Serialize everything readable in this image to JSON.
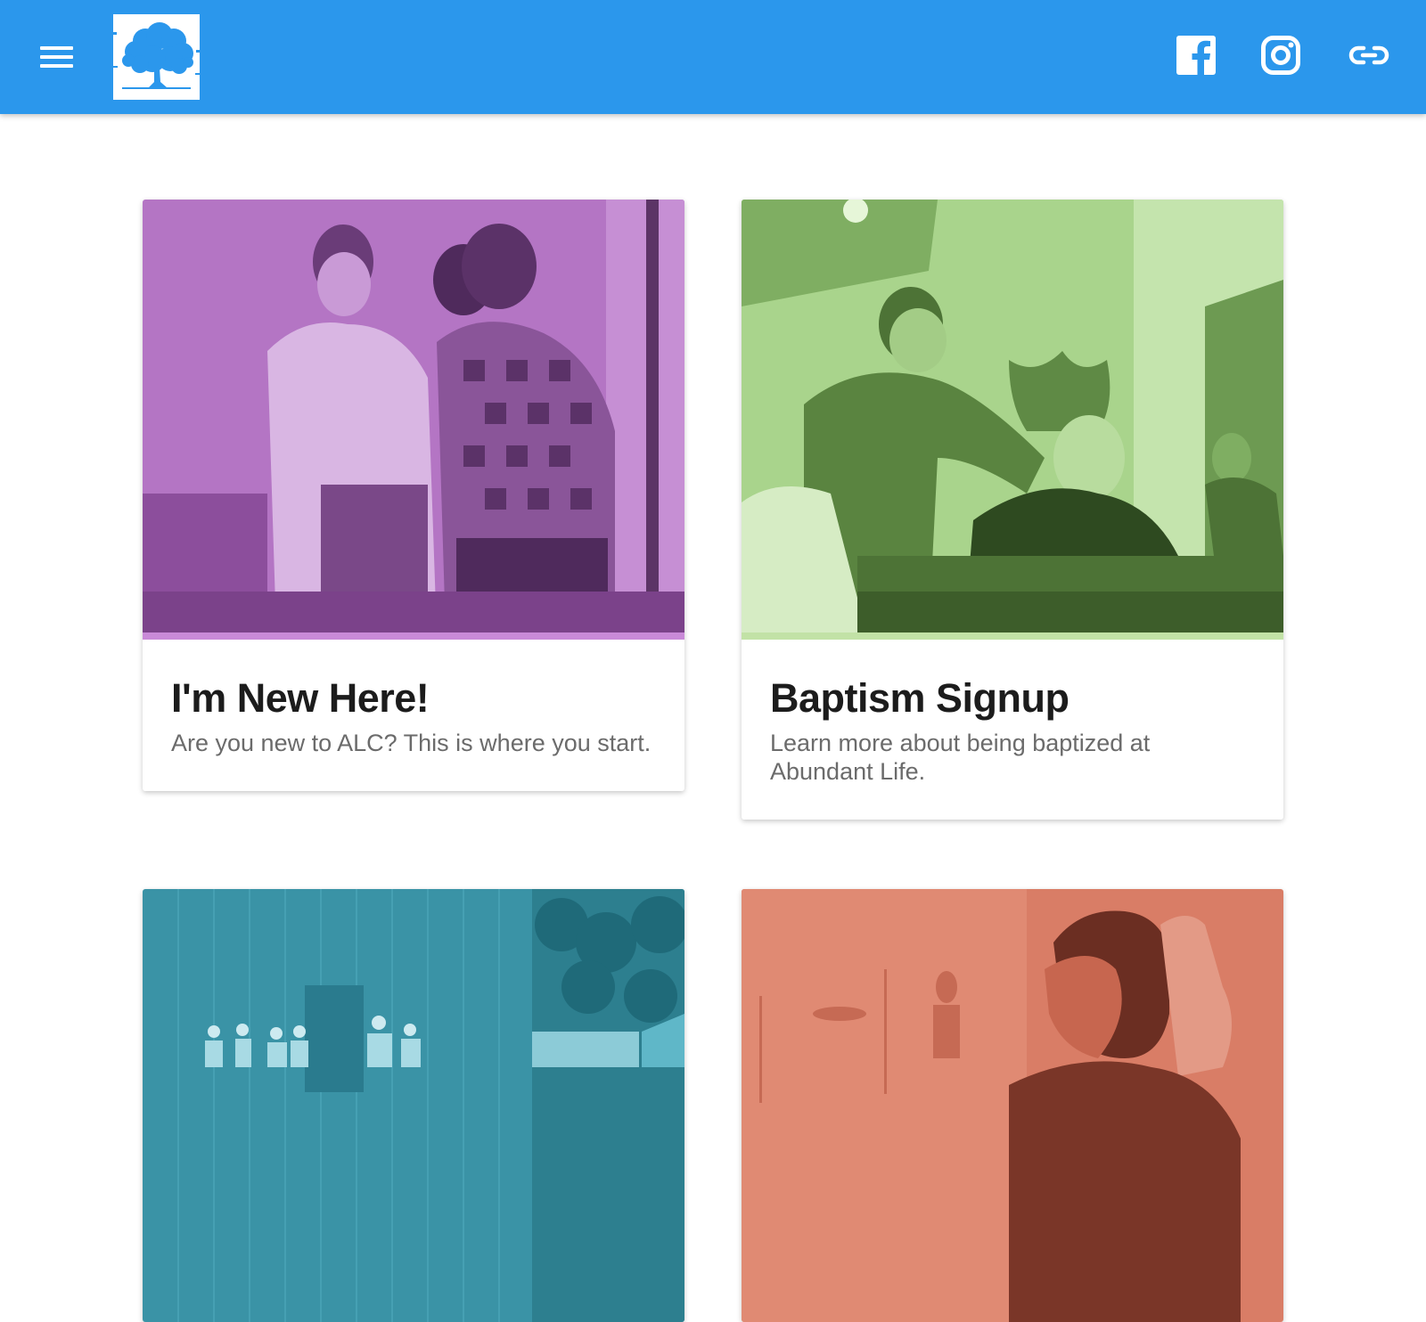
{
  "header": {
    "background_color": "#2b97ec",
    "menu_icon": "hamburger-menu-icon",
    "logo_icon": "tree-logo-icon",
    "social_links": [
      {
        "icon": "facebook-icon"
      },
      {
        "icon": "instagram-icon"
      },
      {
        "icon": "link-icon"
      }
    ]
  },
  "cards": [
    {
      "title": "I'm New Here!",
      "description": "Are you new to ALC? This is where you start.",
      "tint_color": "#b475c4",
      "stripe_color": "#c98ad8"
    },
    {
      "title": "Baptism Signup",
      "description": "Learn more about being baptized at Abundant Life.",
      "tint_color": "#8ab96a",
      "stripe_color": "#c2e2a6"
    },
    {
      "title": "",
      "description": "",
      "tint_color": "#3a93a6"
    },
    {
      "title": "",
      "description": "",
      "tint_color": "#d97d66"
    }
  ]
}
